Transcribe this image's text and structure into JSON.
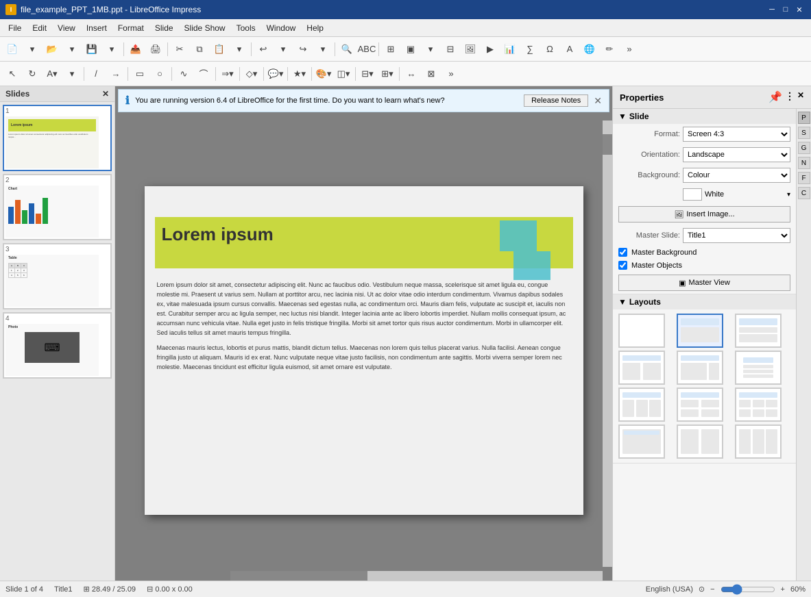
{
  "titleBar": {
    "title": "file_example_PPT_1MB.ppt - LibreOffice Impress",
    "icon": "LO",
    "minimizeBtn": "─",
    "maximizeBtn": "□",
    "closeBtn": "✕"
  },
  "menuBar": {
    "items": [
      "File",
      "Edit",
      "View",
      "Insert",
      "Format",
      "Slide",
      "Slide Show",
      "Tools",
      "Window",
      "Help"
    ]
  },
  "notification": {
    "icon": "ℹ",
    "text": "You are running version 6.4 of LibreOffice for the first time. Do you want to learn what's new?",
    "buttonLabel": "Release Notes",
    "closeIcon": "✕"
  },
  "slidesPanel": {
    "title": "Slides",
    "closeIcon": "✕",
    "slides": [
      {
        "number": "1",
        "label": "Lorem ipsum"
      },
      {
        "number": "2",
        "label": "Chart"
      },
      {
        "number": "3",
        "label": "Table"
      },
      {
        "number": "4",
        "label": "Photo"
      }
    ]
  },
  "mainSlide": {
    "title": "Lorem ipsum",
    "body1": "Lorem ipsum dolor sit amet, consectetur adipiscing elit. Nunc ac faucibus odio. Vestibulum neque massa, scelerisque sit amet ligula eu, congue molestie mi. Praesent ut varius sem. Nullam at porttitor arcu, nec lacinia nisi. Ut ac dolor vitae odio interdum condimentum. Vivamus dapibus sodales ex, vitae malesuada ipsum cursus convallis. Maecenas sed egestas nulla, ac condimentum orci. Mauris diam felis, vulputate ac suscipit et, iaculis non est. Curabitur semper arcu ac ligula semper, nec luctus nisi blandit. Integer lacinia ante ac libero lobortis imperdiet. Nullam mollis consequat ipsum, ac accumsan nunc vehicula vitae. Nulla eget justo in felis tristique fringilla. Morbi sit amet tortor quis risus auctor condimentum. Morbi in ullamcorper elit. Sed iaculis tellus sit amet mauris tempus fringilla.",
    "body2": "Maecenas mauris lectus, lobortis et purus mattis, blandit dictum tellus. Maecenas non lorem quis tellus placerat varius. Nulla facilisi. Aenean congue fringilla justo ut aliquam. Mauris id ex erat. Nunc vulputate neque vitae justo facilisis, non condimentum ante sagittis. Morbi viverra semper lorem nec molestie. Maecenas tincidunt est efficitur ligula euismod, sit amet ornare est vulputate."
  },
  "propertiesPanel": {
    "title": "Properties",
    "closeIcon": "✕",
    "moreIcon": "⋮",
    "sections": {
      "slide": {
        "label": "Slide",
        "formatLabel": "Format:",
        "formatValue": "Screen 4:3",
        "orientationLabel": "Orientation:",
        "orientationValue": "Landscape",
        "backgroundLabel": "Background:",
        "backgroundValue": "Colour",
        "colorSwatch": "White",
        "insertImageBtn": "Insert Image...",
        "masterSlideLabel": "Master Slide:",
        "masterSlideValue": "Title1",
        "masterBackground": "Master Background",
        "masterObjects": "Master Objects",
        "masterViewBtn": "Master View"
      },
      "layouts": {
        "label": "Layouts"
      }
    }
  },
  "statusBar": {
    "slideInfo": "Slide 1 of 4",
    "layout": "Title1",
    "coordinates": "28.49 / 25.09",
    "size": "0.00 x 0.00",
    "language": "English (USA)",
    "zoom": "60%"
  }
}
